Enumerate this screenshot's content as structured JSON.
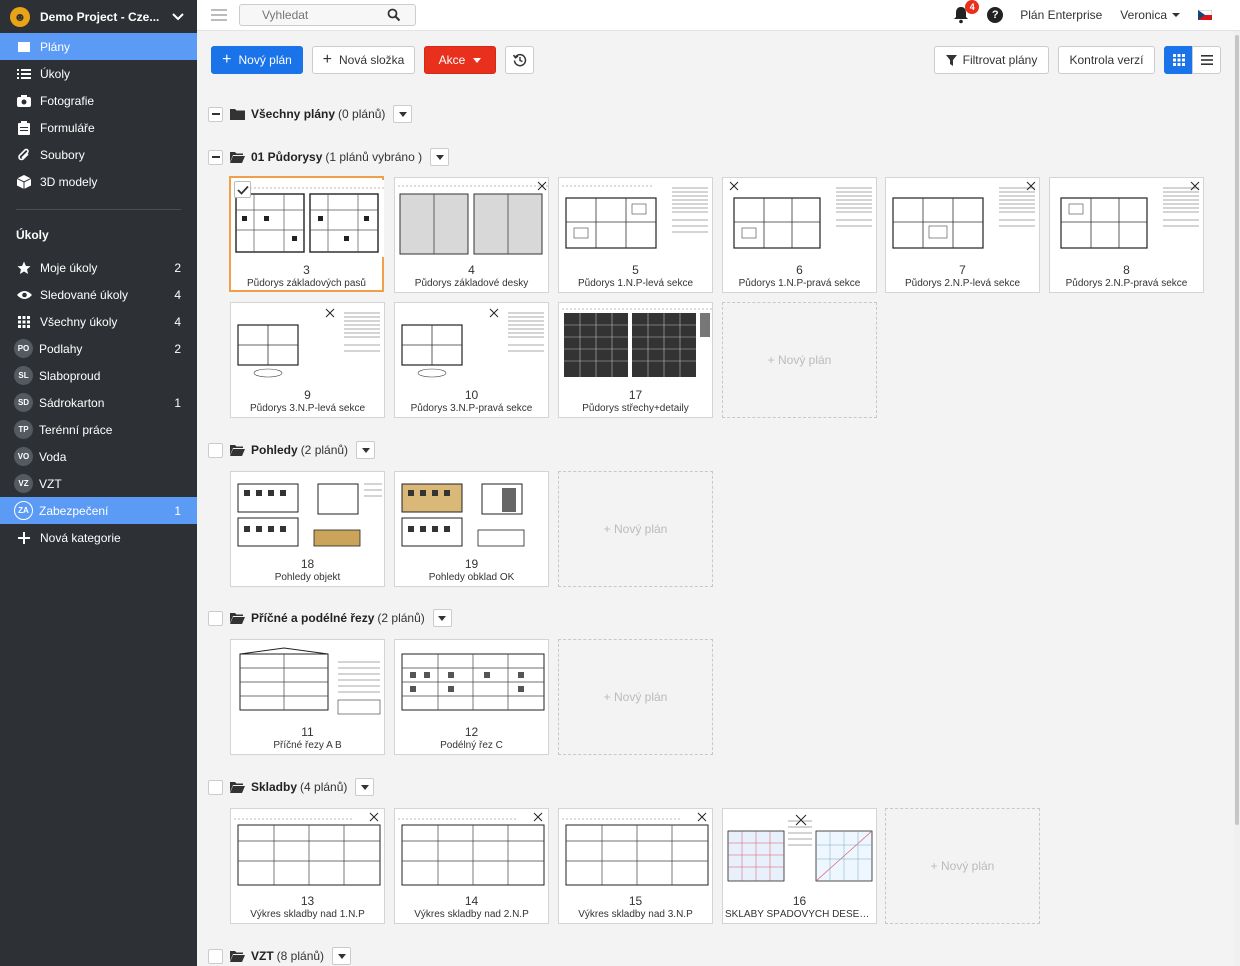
{
  "project": {
    "name": "Demo Project - Cze..."
  },
  "nav": [
    {
      "label": "Plány",
      "icon": "layers-icon",
      "active": true
    },
    {
      "label": "Úkoly",
      "icon": "list-icon"
    },
    {
      "label": "Fotografie",
      "icon": "camera-icon"
    },
    {
      "label": "Formuláře",
      "icon": "clipboard-icon"
    },
    {
      "label": "Soubory",
      "icon": "paperclip-icon"
    },
    {
      "label": "3D modely",
      "icon": "cube-icon"
    }
  ],
  "tasks_section": {
    "title": "Úkoly",
    "items": [
      {
        "label": "Moje úkoly",
        "count": "2",
        "icon": "star-icon"
      },
      {
        "label": "Sledované úkoly",
        "count": "4",
        "icon": "eye-icon"
      },
      {
        "label": "Všechny úkoly",
        "count": "4",
        "icon": "grid-icon"
      },
      {
        "label": "Podlahy",
        "count": "2",
        "abbr": "PO"
      },
      {
        "label": "Slaboproud",
        "count": "",
        "abbr": "SL"
      },
      {
        "label": "Sádrokarton",
        "count": "1",
        "abbr": "SD"
      },
      {
        "label": "Terénní práce",
        "count": "",
        "abbr": "TP"
      },
      {
        "label": "Voda",
        "count": "",
        "abbr": "VO"
      },
      {
        "label": "VZT",
        "count": "",
        "abbr": "VZ"
      },
      {
        "label": "Zabezpečení",
        "count": "1",
        "abbr": "ZA",
        "active": true
      },
      {
        "label": "Nová kategorie",
        "count": "",
        "icon": "plus-icon"
      }
    ]
  },
  "topbar": {
    "search_placeholder": "Vyhledat",
    "notifications": "4",
    "help": "?",
    "plan": "Plán Enterprise",
    "user": "Veronica"
  },
  "toolbar": {
    "new_plan": "Nový plán",
    "new_folder": "Nová složka",
    "actions": "Akce",
    "filter": "Filtrovat plány",
    "version_check": "Kontrola verzí"
  },
  "folders": {
    "all": {
      "name": "Všechny plány",
      "count": "(0 plánů)"
    },
    "pudorysy": {
      "name": "01 Půdorysy",
      "count": "(1 plánů vybráno )"
    },
    "pohledy": {
      "name": "Pohledy",
      "count": "(2 plánů)"
    },
    "rezy": {
      "name": "Příčné a podélné řezy",
      "count": "(2 plánů)"
    },
    "skladby": {
      "name": "Skladby",
      "count": "(4 plánů)"
    },
    "vzt": {
      "name": "VZT",
      "count": "(8 plánů)"
    }
  },
  "new_plan_card": "+ Nový plán",
  "plans": [
    {
      "num": "3",
      "title": "Půdorys základových pasů",
      "selected": true
    },
    {
      "num": "4",
      "title": "Půdorys základové desky"
    },
    {
      "num": "5",
      "title": "Půdorys 1.N.P-levá sekce"
    },
    {
      "num": "6",
      "title": "Půdorys 1.N.P-pravá sekce"
    },
    {
      "num": "7",
      "title": "Půdorys 2.N.P-levá sekce"
    },
    {
      "num": "8",
      "title": "Půdorys 2.N.P-pravá sekce"
    },
    {
      "num": "9",
      "title": "Půdorys 3.N.P-levá sekce"
    },
    {
      "num": "10",
      "title": "Půdorys 3.N.P-pravá sekce"
    },
    {
      "num": "17",
      "title": "Půdorys střechy+detaily"
    },
    {
      "num": "18",
      "title": "Pohledy objekt"
    },
    {
      "num": "19",
      "title": "Pohledy obklad OK"
    },
    {
      "num": "11",
      "title": "Příčné řezy A B"
    },
    {
      "num": "12",
      "title": "Podélný řez C"
    },
    {
      "num": "13",
      "title": "Výkres skladby nad 1.N.P"
    },
    {
      "num": "14",
      "title": "Výkres skladby nad 2.N.P"
    },
    {
      "num": "15",
      "title": "Výkres skladby nad 3.N.P"
    },
    {
      "num": "16",
      "title": "SKLABY SPÁDOVÝCH DESEK..."
    }
  ],
  "colors": {
    "sidebar": "#2d3135",
    "accent": "#1a73e8",
    "active_nav": "#5b9bf5",
    "danger": "#e8301c",
    "selected_border": "#f0a04b"
  }
}
